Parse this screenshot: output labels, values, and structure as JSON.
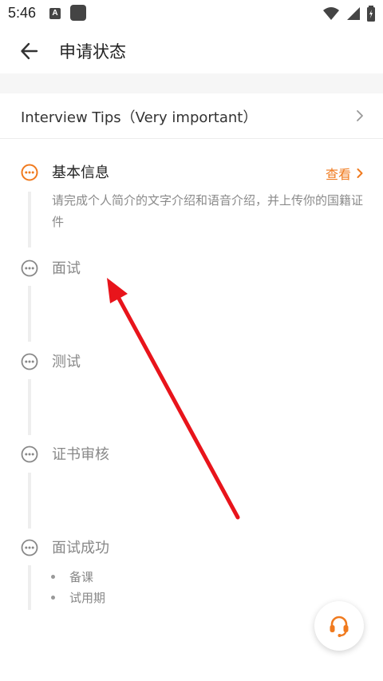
{
  "status_bar": {
    "time": "5:46",
    "a_badge": "A"
  },
  "header": {
    "title": "申请状态"
  },
  "tips": {
    "label": "Interview Tips（Very important）"
  },
  "steps": [
    {
      "title": "基本信息",
      "action_label": "查看",
      "description": "请完成个人简介的文字介绍和语音介绍，并上传你的国籍证件"
    },
    {
      "title": "面试"
    },
    {
      "title": "测试"
    },
    {
      "title": "证书审核"
    },
    {
      "title": "面试成功",
      "sub_items": [
        "备课",
        "试用期"
      ]
    }
  ],
  "colors": {
    "accent": "#f07a1e",
    "inactive": "#888888",
    "annotation_arrow": "#e8141b"
  },
  "icons": {
    "back": "arrow-left-icon",
    "tips_chevron": "chevron-right-icon",
    "step": "more-dots-circle-icon",
    "support": "headset-icon"
  }
}
